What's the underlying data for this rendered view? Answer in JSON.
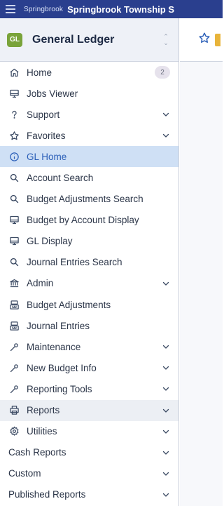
{
  "topbar": {
    "logo_text": "Springbrook",
    "title": "Springbrook Township S"
  },
  "module": {
    "badge": "GL",
    "name": "General Ledger"
  },
  "nav": [
    {
      "label": "Home",
      "icon": "home-icon",
      "badge": "2",
      "chevron": false
    },
    {
      "label": "Jobs Viewer",
      "icon": "monitor-icon",
      "chevron": false
    },
    {
      "label": "Support",
      "icon": "question-icon",
      "chevron": true
    },
    {
      "label": "Favorites",
      "icon": "star-icon",
      "chevron": true
    },
    {
      "label": "GL Home",
      "icon": "info-icon",
      "chevron": false,
      "state": "active"
    },
    {
      "label": "Account Search",
      "icon": "search-icon",
      "chevron": false
    },
    {
      "label": "Budget Adjustments Search",
      "icon": "search-icon",
      "chevron": false
    },
    {
      "label": "Budget by Account Display",
      "icon": "monitor-icon",
      "chevron": false
    },
    {
      "label": "GL Display",
      "icon": "monitor-icon",
      "chevron": false
    },
    {
      "label": "Journal Entries Search",
      "icon": "search-icon",
      "chevron": false
    },
    {
      "label": "Admin",
      "icon": "bank-icon",
      "chevron": true
    },
    {
      "label": "Budget Adjustments",
      "icon": "register-icon",
      "chevron": false
    },
    {
      "label": "Journal Entries",
      "icon": "register-icon",
      "chevron": false
    },
    {
      "label": "Maintenance",
      "icon": "wrench-icon",
      "chevron": true
    },
    {
      "label": "New Budget Info",
      "icon": "wrench-icon",
      "chevron": true
    },
    {
      "label": "Reporting Tools",
      "icon": "wrench-icon",
      "chevron": true
    },
    {
      "label": "Reports",
      "icon": "printer-icon",
      "chevron": true,
      "state": "hover"
    },
    {
      "label": "Utilities",
      "icon": "gear-icon",
      "chevron": true
    },
    {
      "label": "Cash Reports",
      "icon": "",
      "chevron": true
    },
    {
      "label": "Custom",
      "icon": "",
      "chevron": true
    },
    {
      "label": "Published Reports",
      "icon": "",
      "chevron": true
    }
  ],
  "colors": {
    "topbar": "#2a3f8e",
    "module_badge": "#79a33a",
    "active_bg": "#cfe0f5",
    "active_text": "#2b5fb8"
  }
}
